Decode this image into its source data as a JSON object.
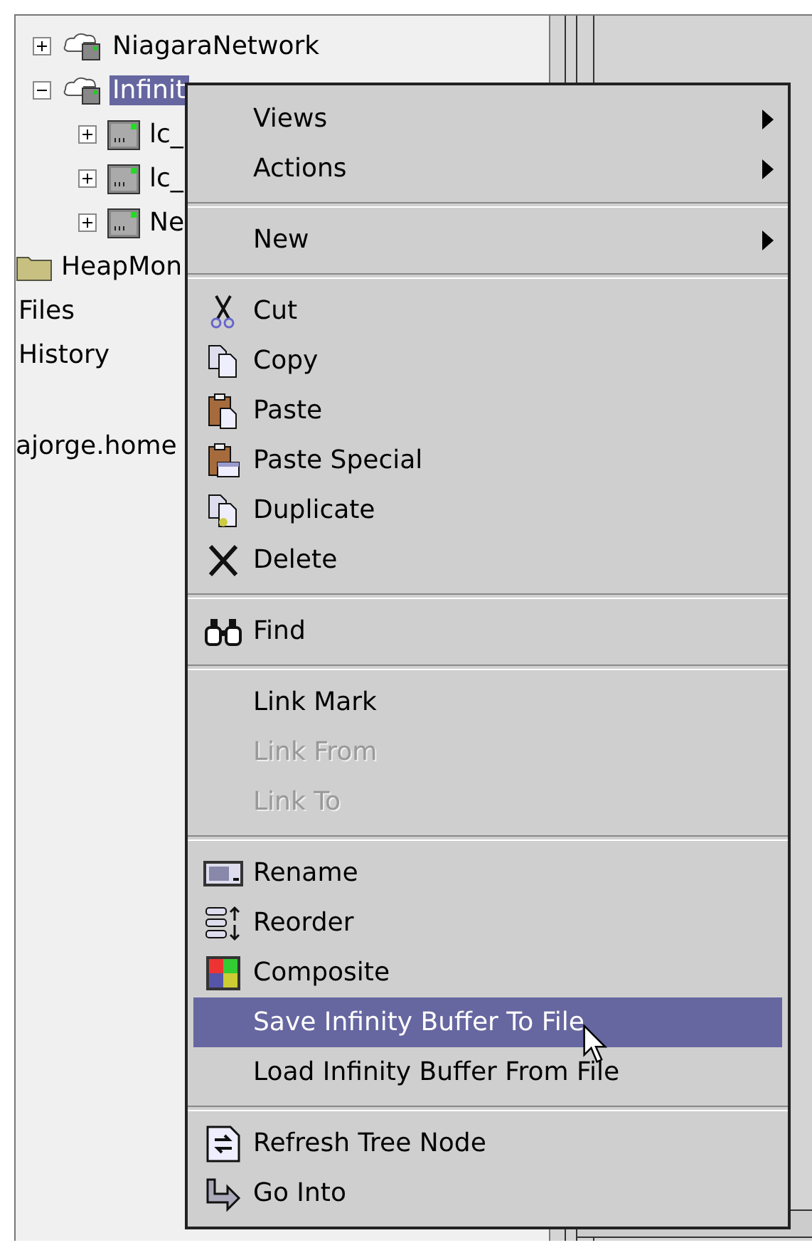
{
  "tree": {
    "items": [
      {
        "label": "NiagaraNetwork",
        "kind": "network",
        "expanded": false,
        "selected": false
      },
      {
        "label": "Infinit",
        "kind": "network",
        "expanded": true,
        "selected": true,
        "children": [
          {
            "label": "lc_",
            "kind": "device",
            "expanded": false,
            "selected": false
          },
          {
            "label": "lc_",
            "kind": "device",
            "expanded": false,
            "selected": false
          },
          {
            "label": "Ne",
            "kind": "device",
            "expanded": false,
            "selected": false
          }
        ]
      },
      {
        "label": "HeapMon",
        "kind": "folder",
        "selected": false
      },
      {
        "label": "Files",
        "kind": "plain",
        "selected": false
      },
      {
        "label": "History",
        "kind": "plain",
        "selected": false
      }
    ],
    "host": "ajorge.home"
  },
  "context_menu": {
    "sections": [
      [
        {
          "label": "Views",
          "submenu": true,
          "disabled": false,
          "selected": false
        },
        {
          "label": "Actions",
          "submenu": true,
          "disabled": false,
          "selected": false
        }
      ],
      [
        {
          "label": "New",
          "submenu": true,
          "disabled": false,
          "selected": false
        }
      ],
      [
        {
          "label": "Cut",
          "kind": "cut",
          "disabled": false,
          "selected": false
        },
        {
          "label": "Copy",
          "kind": "copy",
          "disabled": false,
          "selected": false
        },
        {
          "label": "Paste",
          "kind": "paste",
          "disabled": false,
          "selected": false
        },
        {
          "label": "Paste Special",
          "kind": "paste-special",
          "disabled": false,
          "selected": false
        },
        {
          "label": "Duplicate",
          "kind": "duplicate",
          "disabled": false,
          "selected": false
        },
        {
          "label": "Delete",
          "kind": "delete",
          "disabled": false,
          "selected": false
        }
      ],
      [
        {
          "label": "Find",
          "kind": "find",
          "disabled": false,
          "selected": false
        }
      ],
      [
        {
          "label": "Link Mark",
          "disabled": false,
          "selected": false
        },
        {
          "label": "Link From",
          "disabled": true,
          "selected": false
        },
        {
          "label": "Link To",
          "disabled": true,
          "selected": false
        }
      ],
      [
        {
          "label": "Rename",
          "kind": "rename",
          "disabled": false,
          "selected": false
        },
        {
          "label": "Reorder",
          "kind": "reorder",
          "disabled": false,
          "selected": false
        },
        {
          "label": "Composite",
          "kind": "composite",
          "disabled": false,
          "selected": false
        },
        {
          "label": "Save Infinity Buffer To File",
          "disabled": false,
          "selected": true
        },
        {
          "label": "Load Infinity Buffer From File",
          "disabled": false,
          "selected": false
        }
      ],
      [
        {
          "label": "Refresh Tree Node",
          "kind": "refresh",
          "disabled": false,
          "selected": false
        },
        {
          "label": "Go Into",
          "kind": "go-into",
          "disabled": false,
          "selected": false
        }
      ]
    ]
  }
}
